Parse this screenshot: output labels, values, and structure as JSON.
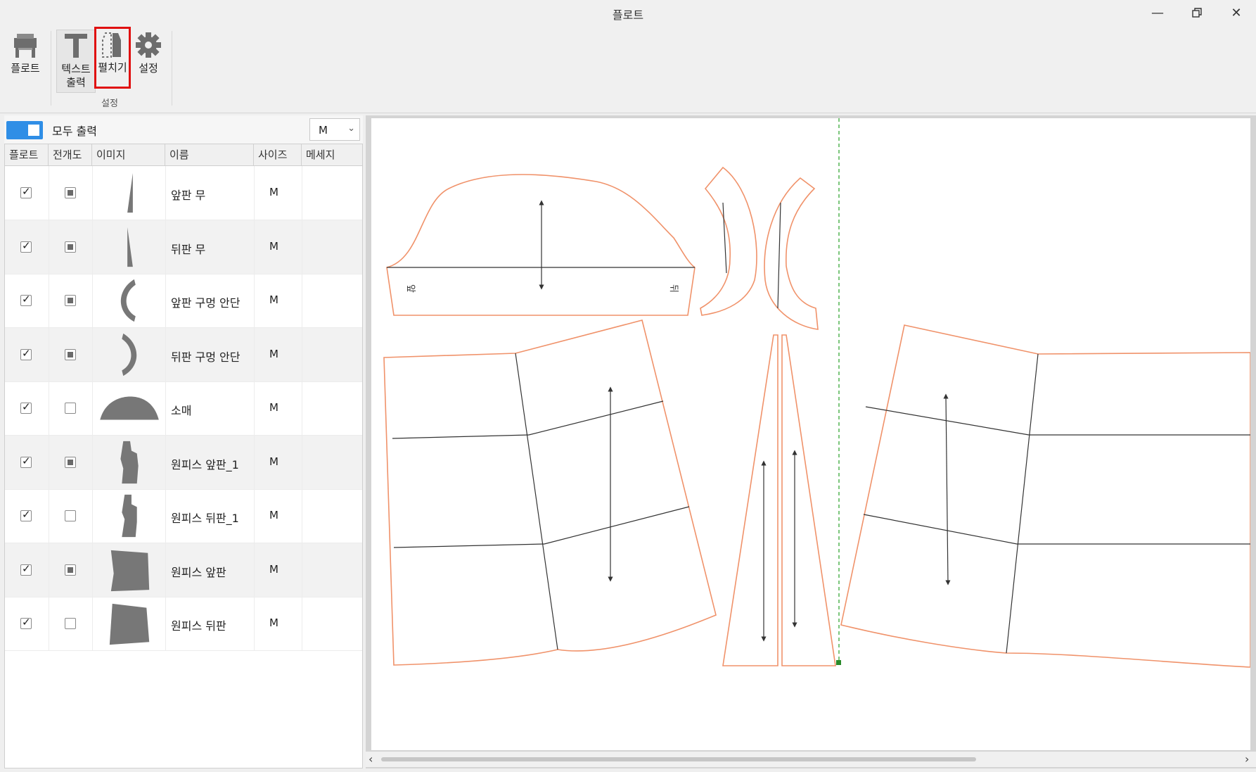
{
  "window": {
    "title": "플로트"
  },
  "ribbon": {
    "plot_label": "플로트",
    "text_output_label": "텍스트 출력",
    "unfold_label": "펼치기",
    "settings_label": "설정",
    "group_label": "설정"
  },
  "panel": {
    "print_all_label": "모두 출력",
    "size_select": "M",
    "columns": [
      "플로트",
      "전개도",
      "이미지",
      "이름",
      "사이즈",
      "메세지"
    ],
    "rows": [
      {
        "name": "앞판 무",
        "size": "M",
        "plot": true,
        "unfold": "partial",
        "shape": "gore"
      },
      {
        "name": "뒤판 무",
        "size": "M",
        "plot": true,
        "unfold": "partial",
        "shape": "gore2"
      },
      {
        "name": "앞판 구멍 안단",
        "size": "M",
        "plot": true,
        "unfold": "partial",
        "shape": "arc-left"
      },
      {
        "name": "뒤판 구멍 안단",
        "size": "M",
        "plot": true,
        "unfold": "partial",
        "shape": "arc-right"
      },
      {
        "name": "소매",
        "size": "M",
        "plot": true,
        "unfold": "none",
        "shape": "sleeve"
      },
      {
        "name": "원피스 앞판_1",
        "size": "M",
        "plot": true,
        "unfold": "partial",
        "shape": "bodice"
      },
      {
        "name": "원피스 뒤판_1",
        "size": "M",
        "plot": true,
        "unfold": "none",
        "shape": "bodice2"
      },
      {
        "name": "원피스 앞판",
        "size": "M",
        "plot": true,
        "unfold": "partial",
        "shape": "panel"
      },
      {
        "name": "원피스 뒤판",
        "size": "M",
        "plot": true,
        "unfold": "none",
        "shape": "panel2"
      }
    ]
  },
  "canvas": {
    "label_front": "앞",
    "label_back": "뒤",
    "pattern_color": "#f0926a",
    "guide_color": "#5cb85c"
  },
  "highlight_color": "#e01010"
}
